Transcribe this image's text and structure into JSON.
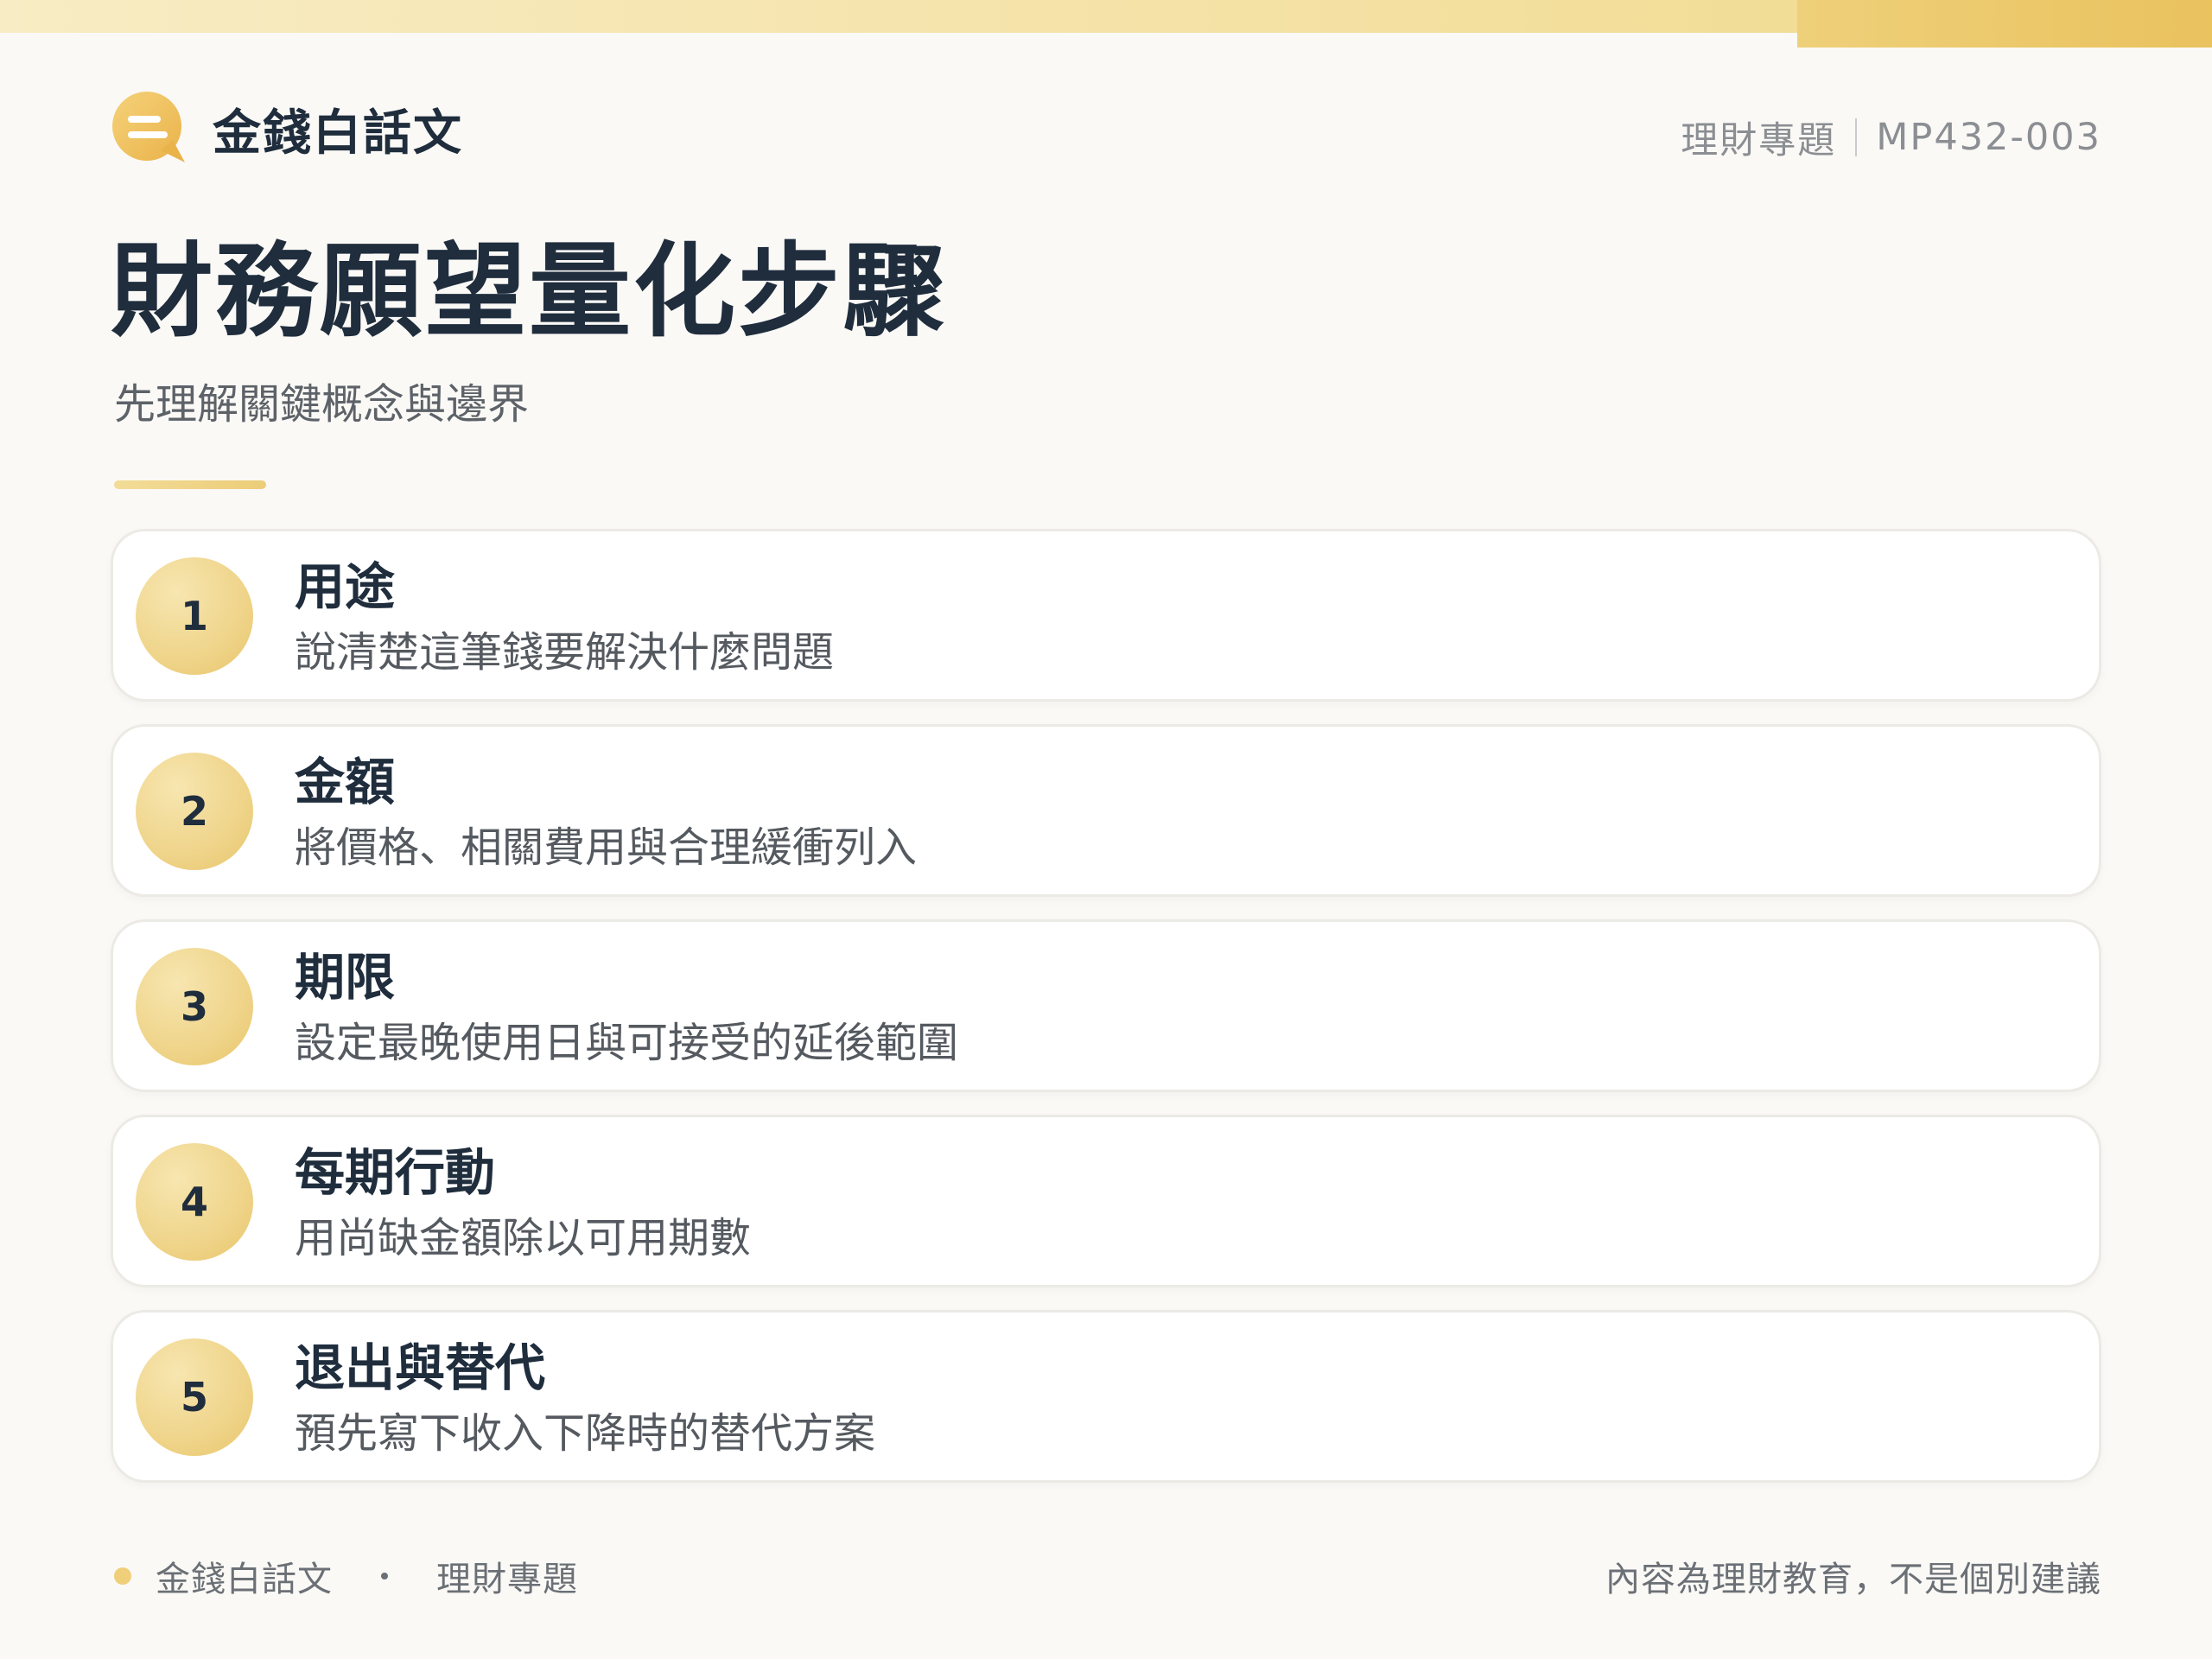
{
  "brand": {
    "name": "金錢白話文",
    "icon": "chat-bubble-icon",
    "color": "#eec15b"
  },
  "meta": {
    "category": "理財專題",
    "code": "MP432-003"
  },
  "page": {
    "title": "財務願望量化步驟",
    "subtitle": "先理解關鍵概念與邊界"
  },
  "steps": [
    {
      "number": "1",
      "title": "用途",
      "description": "說清楚這筆錢要解決什麼問題"
    },
    {
      "number": "2",
      "title": "金額",
      "description": "將價格、相關費用與合理緩衝列入"
    },
    {
      "number": "3",
      "title": "期限",
      "description": "設定最晚使用日與可接受的延後範圍"
    },
    {
      "number": "4",
      "title": "每期行動",
      "description": "用尚缺金額除以可用期數"
    },
    {
      "number": "5",
      "title": "退出與替代",
      "description": "預先寫下收入下降時的替代方案"
    }
  ],
  "footer": {
    "brand": "金錢白話文",
    "category": "理財專題",
    "disclaimer": "內容為理財教育，不是個別建議"
  }
}
